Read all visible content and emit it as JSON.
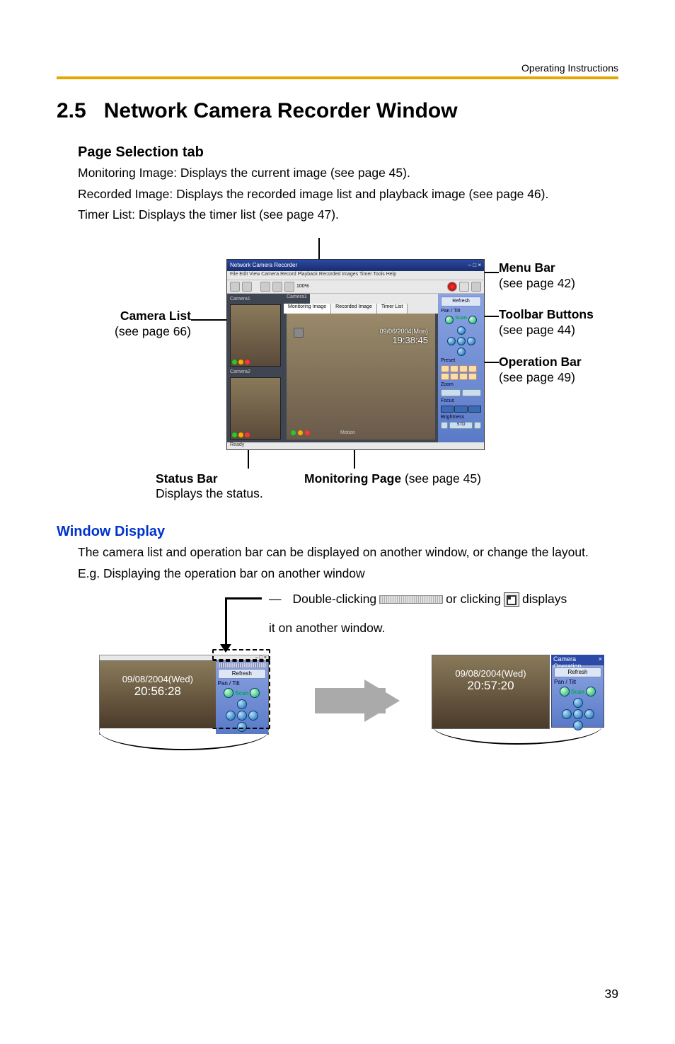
{
  "running_head": "Operating Instructions",
  "section_number": "2.5",
  "section_title": "Network Camera Recorder Window",
  "page_sel_heading": "Page Selection tab",
  "body1": "Monitoring Image: Displays the current image (see page 45).",
  "body2": "Recorded Image: Displays the recorded image list and playback image (see page 46).",
  "body3": "Timer List: Displays the timer list (see page 47).",
  "callouts": {
    "camera_list_t": "Camera List",
    "camera_list_s": "(see page 66)",
    "menu_bar_t": "Menu Bar",
    "menu_bar_s": "(see page 42)",
    "toolbar_t": "Toolbar Buttons",
    "toolbar_s": "(see page 44)",
    "operation_t": "Operation Bar",
    "operation_s": "(see page 49)",
    "status_t": "Status Bar",
    "status_s": "Displays the status.",
    "monitoring_t": "Monitoring Page",
    "monitoring_s": " (see page 45)"
  },
  "shot": {
    "title": "Network Camera Recorder",
    "menus": "File   Edit   View   Camera   Record   Playback   Recorded Images   Timer   Tools   Help",
    "zoom": "100%",
    "cam_label1": "Camera1",
    "cam_label2": "Camera2",
    "tab1": "Monitoring Image",
    "tab2": "Recorded Image",
    "tab3": "Timer List",
    "time1": "09/06/2004(Mon)",
    "time2": "19:38:45",
    "refresh": "Refresh",
    "pantilt": "Pan / Tilt",
    "scan": "Scan",
    "preset": "Preset",
    "zoom_lbl": "Zoom",
    "focus": "Focus",
    "bright": "Brightness",
    "std": "STD",
    "status": "Ready",
    "motion": "Motion"
  },
  "window_display_h": "Window Display",
  "wd_body1": "The camera list and operation bar can be displayed on another window, or change the layout.",
  "wd_body2": "E.g. Displaying the operation bar on another window",
  "wd_instr1": "Double-clicking ",
  "wd_instr2": " or clicking ",
  "wd_instr3": " displays",
  "wd_instr4": "it on another window.",
  "mini": {
    "refresh": "Refresh",
    "pantilt": "Pan / Tilt",
    "scan": "Scan",
    "left_time1": "09/08/2004(Wed)",
    "left_time2": "20:56:28",
    "right_time1": "09/08/2004(Wed)",
    "right_time2": "20:57:20",
    "panel_title": "Camera Operation"
  },
  "page_number": "39"
}
